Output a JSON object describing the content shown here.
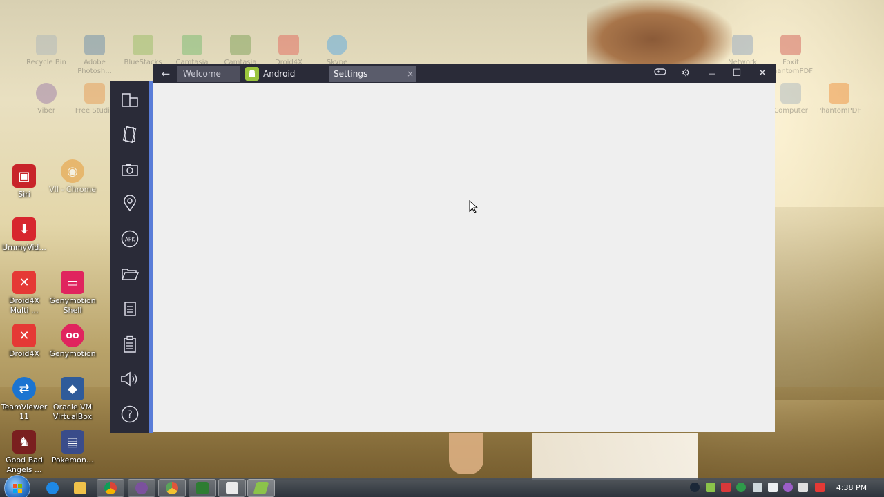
{
  "desktop": {
    "faded_icons": [
      {
        "label": "Recycle Bin"
      },
      {
        "label": "Adobe Photosh..."
      },
      {
        "label": "BlueStacks"
      },
      {
        "label": "Camtasia"
      },
      {
        "label": "Camtasia"
      },
      {
        "label": "Droid4X"
      },
      {
        "label": "Skype"
      },
      {
        "label": "Computer"
      },
      {
        "label": "Network"
      },
      {
        "label": "Foxit PhantomPDF"
      },
      {
        "label": "Viber"
      },
      {
        "label": "Free Studio"
      },
      {
        "label": "PhantomPDF"
      }
    ],
    "icons": [
      {
        "label": "Siri",
        "color": "#c8242a",
        "glyph": "▣"
      },
      {
        "label": "VII - Chrome",
        "color": "#e8a040",
        "glyph": "◉"
      },
      {
        "label": "UmmyVid...",
        "color": "#d7262e",
        "glyph": "⬇"
      },
      {
        "label": "Droid4X Multi ...",
        "color": "#e53935",
        "glyph": "✕"
      },
      {
        "label": "Genymotion Shell",
        "color": "#e0245e",
        "glyph": "▭"
      },
      {
        "label": "Droid4X",
        "color": "#e53935",
        "glyph": "✕"
      },
      {
        "label": "Genymotion",
        "color": "#e0245e",
        "glyph": "oo"
      },
      {
        "label": "TeamViewer 11",
        "color": "#1b74d1",
        "glyph": "⇄"
      },
      {
        "label": "Oracle VM VirtualBox",
        "color": "#2f5b9a",
        "glyph": "◆"
      },
      {
        "label": "Good Bad Angels ...",
        "color": "#7a1f1f",
        "glyph": "♞"
      },
      {
        "label": "Pokemon...",
        "color": "#3a4c8a",
        "glyph": "▤"
      }
    ]
  },
  "window": {
    "tabs": {
      "welcome": "Welcome",
      "android": "Android",
      "settings": "Settings"
    },
    "close_tab_glyph": "×",
    "controls": {
      "gamepad": "🎮",
      "settings": "⚙",
      "minimize": "—",
      "maximize": "☐",
      "close": "✕"
    },
    "back_glyph": "←",
    "sidebar": [
      "rotate",
      "shake",
      "screenshot",
      "location",
      "apk",
      "folder",
      "copy",
      "paste",
      "volume",
      "help"
    ],
    "accent_color": "#5a7dd8"
  },
  "taskbar": {
    "pinned": [
      "internet-explorer",
      "file-explorer",
      "chrome",
      "viber",
      "chrome-canary",
      "camtasia-recorder",
      "camtasia-studio",
      "bluestacks"
    ],
    "clock": "4:38 PM"
  }
}
